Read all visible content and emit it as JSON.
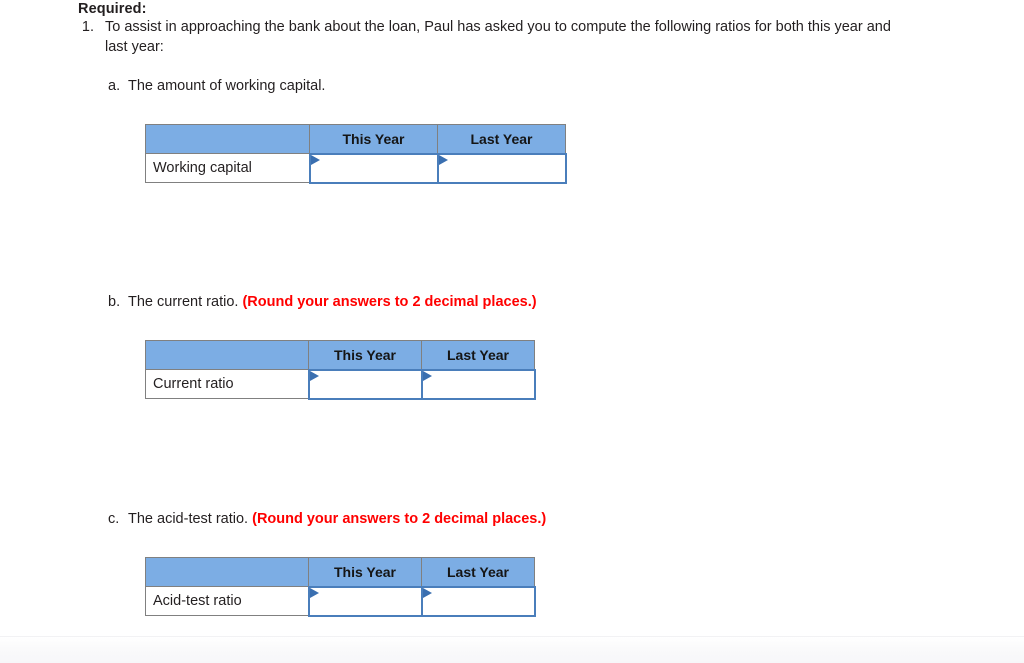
{
  "document": {
    "heading": "Required:",
    "item_number": "1.",
    "item_text": "To assist in approaching the bank about the loan, Paul has asked you to compute the following ratios for both this year and last year:",
    "round_note": "(Round your answers to 2 decimal places.)"
  },
  "sub_items": [
    {
      "letter": "a.",
      "text": "The amount of working capital.",
      "has_round_note": false
    },
    {
      "letter": "b.",
      "text": "The current ratio.",
      "has_round_note": true
    },
    {
      "letter": "c.",
      "text": "The acid-test ratio.",
      "has_round_note": true
    }
  ],
  "tables": [
    {
      "id": "a",
      "corner_header": "",
      "headers": [
        "This Year",
        "Last Year"
      ],
      "row_label": "Working capital",
      "values": [
        "",
        ""
      ]
    },
    {
      "id": "b",
      "corner_header": "",
      "headers": [
        "This Year",
        "Last Year"
      ],
      "row_label": "Current ratio",
      "values": [
        "",
        ""
      ]
    },
    {
      "id": "c",
      "corner_header": "",
      "headers": [
        "This Year",
        "Last Year"
      ],
      "row_label": "Acid-test ratio",
      "values": [
        "",
        ""
      ]
    }
  ],
  "colors": {
    "header_blue": "#7cadE4",
    "input_border_blue": "#4a7ebb",
    "triangle_blue": "#3a6fb0",
    "cell_border_gray": "#808080",
    "red_note": "#ff0000",
    "text": "#231f20"
  }
}
